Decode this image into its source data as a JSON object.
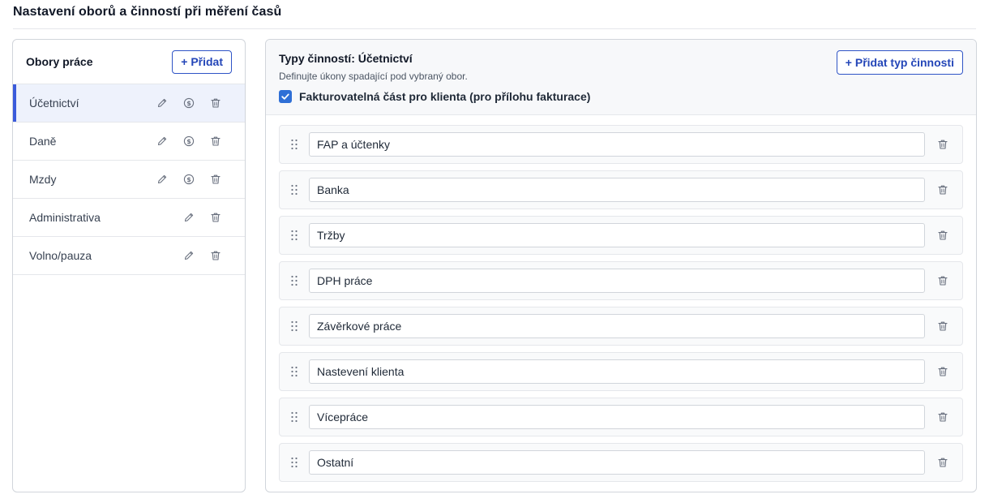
{
  "page": {
    "title": "Nastavení oborů a činností při měření časů"
  },
  "left_panel": {
    "title": "Obory práce",
    "add_label": "+ Přidat",
    "items": [
      {
        "label": "Účetnictví",
        "active": true,
        "icons": [
          "pencil-icon",
          "dollar-circle-icon",
          "trash-icon"
        ]
      },
      {
        "label": "Daně",
        "active": false,
        "icons": [
          "pencil-icon",
          "dollar-circle-icon",
          "trash-icon"
        ]
      },
      {
        "label": "Mzdy",
        "active": false,
        "icons": [
          "pencil-icon",
          "dollar-circle-icon",
          "trash-icon"
        ]
      },
      {
        "label": "Administrativa",
        "active": false,
        "icons": [
          "pencil-icon",
          "trash-icon"
        ]
      },
      {
        "label": "Volno/pauza",
        "active": false,
        "icons": [
          "pencil-icon",
          "trash-icon"
        ]
      }
    ]
  },
  "right_panel": {
    "title": "Typy činností: Účetnictví",
    "subtitle": "Definujte úkony spadající pod vybraný obor.",
    "billable_label": "Fakturovatelná část pro klienta (pro přílohu fakturace)",
    "billable_checked": true,
    "add_label": "+ Přidat typ činnosti",
    "activities": [
      "FAP a účtenky",
      "Banka",
      "Tržby",
      "DPH práce",
      "Závěrkové práce",
      "Nastevení klienta",
      "Vícepráce",
      "Ostatní"
    ]
  },
  "colors": {
    "accent": "#2f54c6",
    "active_bg": "#eef2fc",
    "active_bar": "#3b5bdb",
    "checkbox": "#2f6fd6"
  }
}
